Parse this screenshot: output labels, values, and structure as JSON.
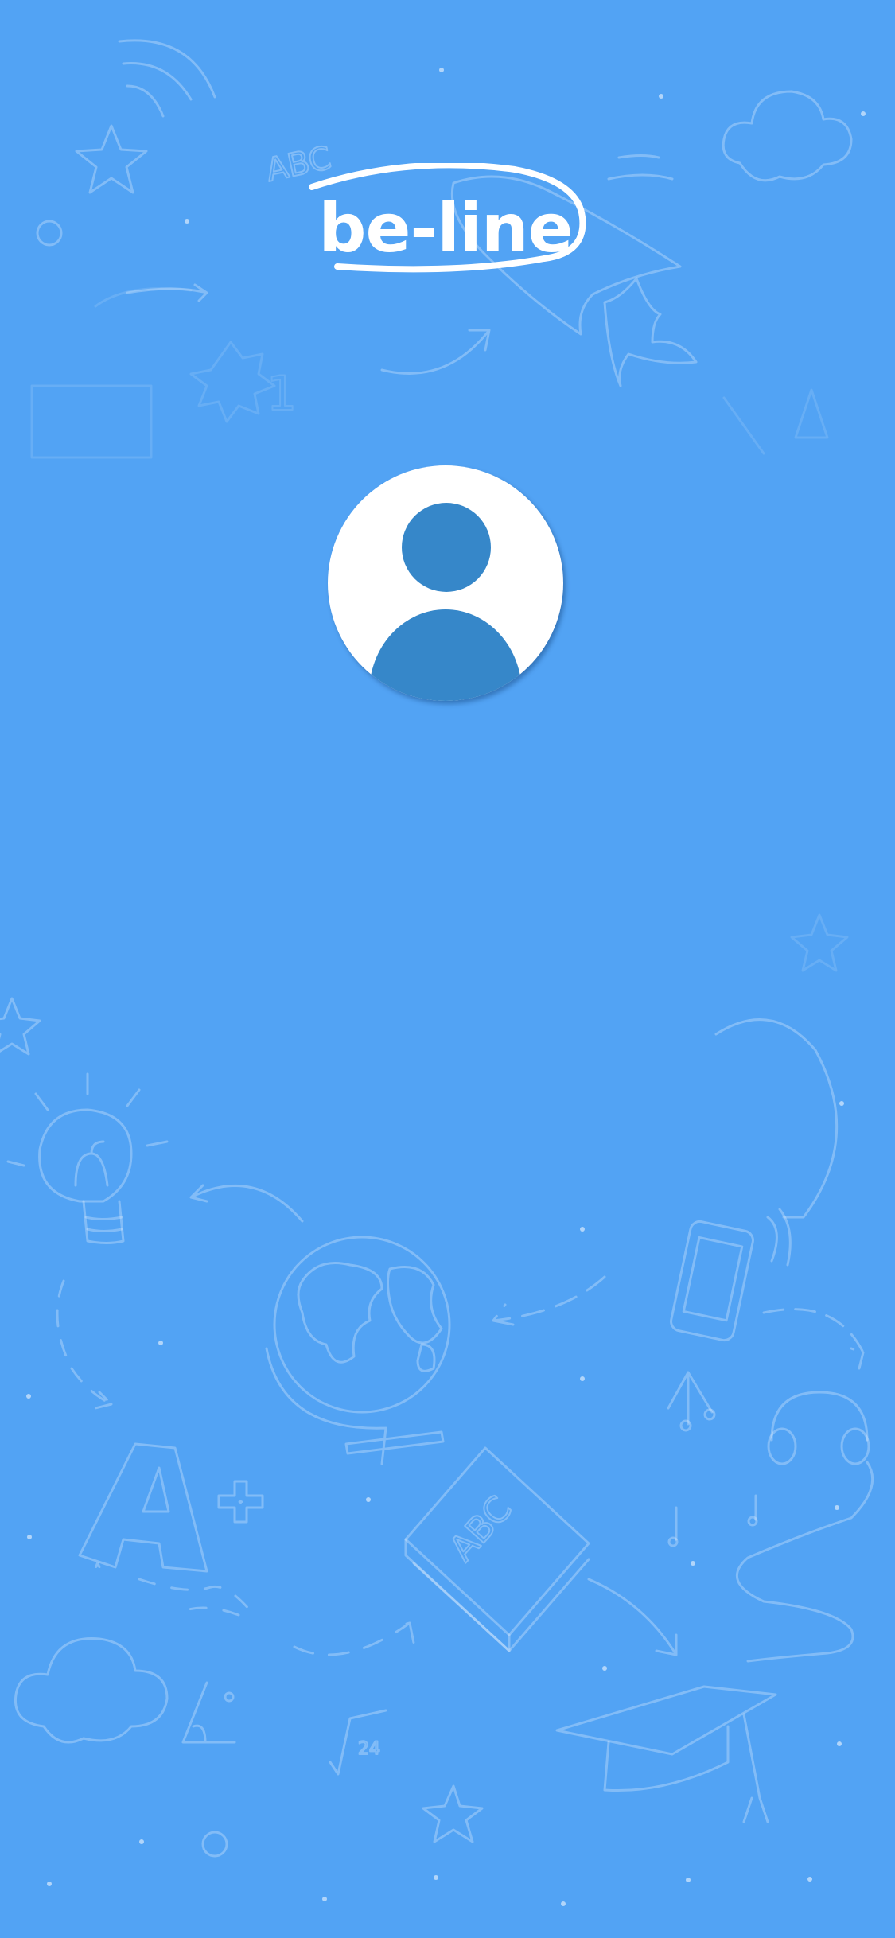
{
  "app": {
    "logo_text": "be-line"
  },
  "profile": {
    "avatar_icon": "user-avatar-icon"
  },
  "background": {
    "color": "#52a3f4",
    "avatar_fill": "#3687c9",
    "doodle_icons": [
      "wifi-icon",
      "star-icon",
      "cloud-icon",
      "rocket-icon",
      "lightbulb-icon",
      "globe-icon",
      "smartphone-icon",
      "music-note-icon",
      "headphones-icon",
      "book-icon",
      "graduation-cap-icon",
      "grade-icon",
      "square-root-icon",
      "angle-icon"
    ],
    "doodle_texts": {
      "abc_top": "ABC",
      "book_label": "ABC",
      "grade_letter": "A",
      "grade_plus": "+",
      "sqrt_value": "24",
      "badge_number": "1"
    }
  }
}
